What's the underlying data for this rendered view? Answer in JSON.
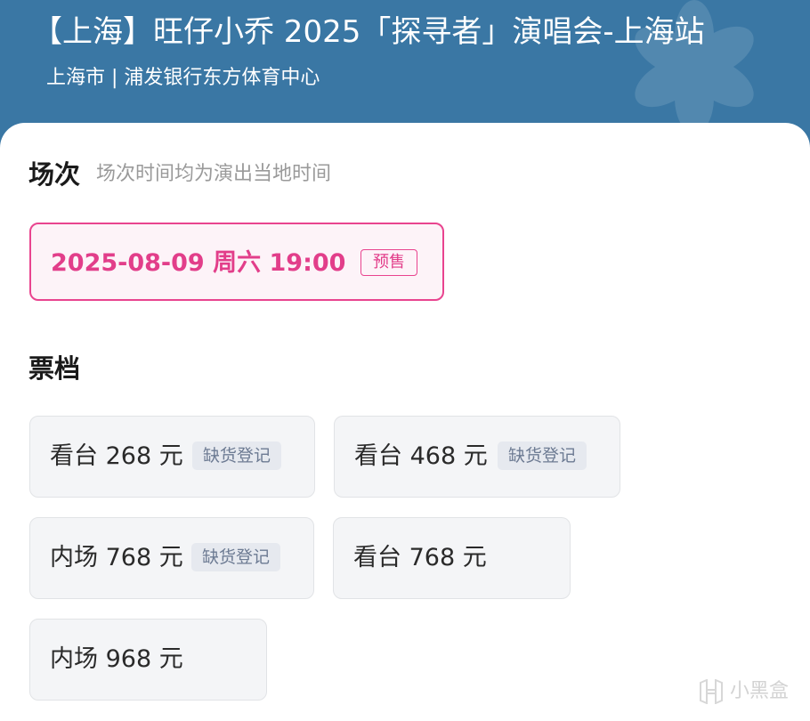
{
  "header": {
    "title": "【上海】旺仔小乔 2025「探寻者」演唱会-上海站",
    "venue": "上海市 | 浦发银行东方体育中心"
  },
  "session_section": {
    "title": "场次",
    "hint": "场次时间均为演出当地时间",
    "sessions": [
      {
        "datetime": "2025-08-09  周六 19:00",
        "badge": "预售"
      }
    ]
  },
  "ticket_section": {
    "title": "票档",
    "tickets": [
      {
        "label": "看台 268 元",
        "badge": "缺货登记"
      },
      {
        "label": "看台 468 元",
        "badge": "缺货登记"
      },
      {
        "label": "内场 768 元",
        "badge": "缺货登记"
      },
      {
        "label": "看台 768 元"
      },
      {
        "label": "内场 968 元"
      }
    ]
  },
  "watermark": {
    "text": "小黑盒",
    "icon": "heybox-logo-icon"
  },
  "colors": {
    "header_bg": "#3a77a4",
    "accent_pink": "#e23e8a",
    "badge_text": "#6d7b93"
  }
}
